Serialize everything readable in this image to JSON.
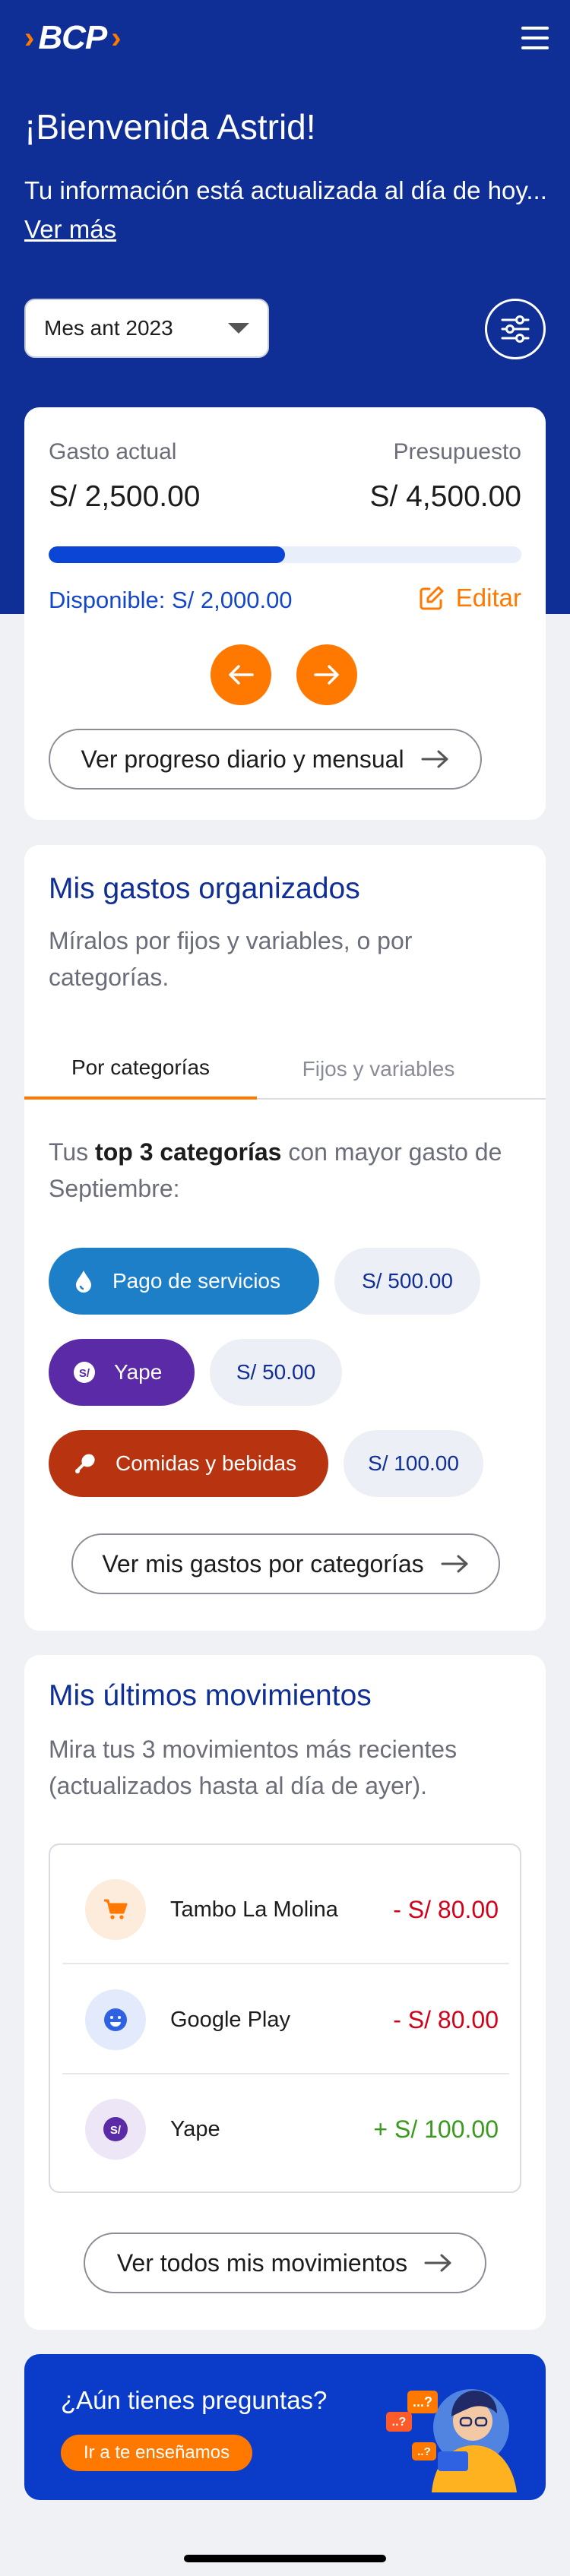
{
  "header": {
    "brand": "BCP",
    "greeting": "¡Bienvenida Astrid!",
    "subtitle": "Tu información está actualizada al día de hoy...",
    "more_link": "Ver más",
    "month_select": "Mes ant 2023"
  },
  "budget": {
    "spent_label": "Gasto actual",
    "spent_value": "S/ 2,500.00",
    "budget_label": "Presupuesto",
    "budget_value": "S/ 4,500.00",
    "progress_fraction": 0.5,
    "available": "Disponible: S/ 2,000.00",
    "edit_label": "Editar",
    "progress_button": "Ver progreso diario y mensual"
  },
  "expenses": {
    "title": "Mis gastos organizados",
    "description": "Míralos por fijos y variables, o por categorías.",
    "tabs": [
      "Por categorías",
      "Fijos y variables"
    ],
    "intro_prefix": "Tus ",
    "intro_bold": "top 3 categorías",
    "intro_suffix": " con mayor gasto de Septiembre:",
    "categories": [
      {
        "name": "Pago de servicios",
        "amount": "S/ 500.00",
        "color": "#1e7fc9",
        "icon": "water-drop-icon"
      },
      {
        "name": "Yape",
        "amount": "S/ 50.00",
        "color": "#5b2aa6",
        "icon": "yape-icon"
      },
      {
        "name": "Comidas y bebidas",
        "amount": "S/ 100.00",
        "color": "#b8330f",
        "icon": "drumstick-icon"
      }
    ],
    "button": "Ver mis gastos por categorías"
  },
  "movements": {
    "title": "Mis últimos movimientos",
    "description": "Mira tus 3 movimientos más recientes (actualizados hasta al día de ayer).",
    "items": [
      {
        "name": "Tambo La Molina",
        "amount": "- S/ 80.00",
        "icon": "cart-icon",
        "color": "#d0021b"
      },
      {
        "name": "Google Play",
        "amount": "- S/ 80.00",
        "icon": "smiley-icon",
        "color": "#d0021b"
      },
      {
        "name": "Yape",
        "amount": "+ S/ 100.00",
        "icon": "yape-icon",
        "color": "#3a9a1e"
      }
    ],
    "button": "Ver todos mis movimientos"
  },
  "help": {
    "question": "¿Aún tienes preguntas?",
    "button": "Ir a te enseñamos"
  }
}
